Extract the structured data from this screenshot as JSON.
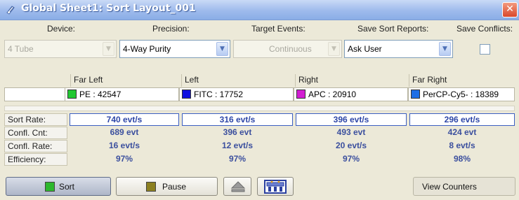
{
  "window": {
    "title": "Global Sheet1: Sort Layout_001",
    "close_label": "✕"
  },
  "settings": {
    "device": {
      "label": "Device:",
      "value": "4 Tube",
      "enabled": false
    },
    "precision": {
      "label": "Precision:",
      "value": "4-Way Purity"
    },
    "target_events": {
      "label": "Target Events:",
      "value": "Continuous",
      "enabled": false
    },
    "save_sort_reports": {
      "label": "Save Sort Reports:",
      "value": "Ask User"
    },
    "save_conflicts": {
      "label": "Save Conflicts:",
      "checked": false
    }
  },
  "sort_locations": [
    {
      "position": "Far Left",
      "parameter": "PE : 42547",
      "swatch_color": "#22c832",
      "sort_rate": "740 evt/s",
      "confl_cnt": "689 evt",
      "confl_rate": "16 evt/s",
      "efficiency": "97%"
    },
    {
      "position": "Left",
      "parameter": "FITC : 17752",
      "swatch_color": "#1010e0",
      "sort_rate": "316 evt/s",
      "confl_cnt": "396 evt",
      "confl_rate": "12 evt/s",
      "efficiency": "97%"
    },
    {
      "position": "Right",
      "parameter": "APC : 20910",
      "swatch_color": "#d21ed2",
      "sort_rate": "396 evt/s",
      "confl_cnt": "493 evt",
      "confl_rate": "20 evt/s",
      "efficiency": "97%"
    },
    {
      "position": "Far Right",
      "parameter": "PerCP-Cy5- : 18389",
      "swatch_color": "#1e6ee6",
      "sort_rate": "296 evt/s",
      "confl_cnt": "424 evt",
      "confl_rate": "8 evt/s",
      "efficiency": "98%"
    }
  ],
  "row_labels": {
    "sort_rate": "Sort Rate:",
    "confl_cnt": "Confl. Cnt:",
    "confl_rate": "Confl. Rate:",
    "efficiency": "Efficiency:"
  },
  "buttons": {
    "sort": {
      "label": "Sort",
      "icon": "green-square-icon",
      "color": "#2db82d"
    },
    "pause": {
      "label": "Pause",
      "icon": "olive-square-icon",
      "color": "#8c8020"
    },
    "eject": {
      "icon": "eject-icon"
    },
    "device_setup": {
      "icon": "device-setup-icon"
    },
    "view_counters": {
      "label": "View Counters"
    }
  }
}
